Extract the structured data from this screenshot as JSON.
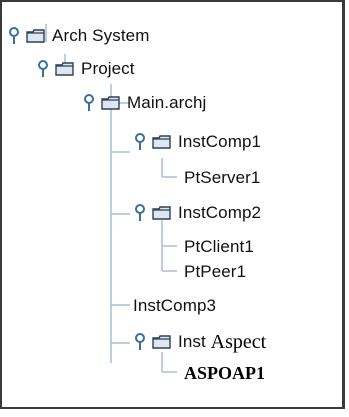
{
  "tree": {
    "nodes": [
      {
        "label": "Arch System"
      },
      {
        "label": "Project"
      },
      {
        "label": "Main.archj"
      },
      {
        "label": "InstComp1"
      },
      {
        "label": "PtServer1"
      },
      {
        "label": "InstComp2"
      },
      {
        "label": "PtClient1"
      },
      {
        "label": "PtPeer1"
      },
      {
        "label": "InstComp3"
      },
      {
        "label_prefix": "Inst ",
        "label_suffix": "Aspect"
      },
      {
        "label": "ASPOAP1"
      }
    ]
  },
  "colors": {
    "line": "#a9bfd6",
    "handle": "#3c6e9b",
    "folder_border": "#2f3f55",
    "folder_fill": "#dde6f1",
    "frame": "#3a3a3a"
  },
  "icons": {
    "expanded_handle": "key-handle-icon",
    "folder": "folder-icon"
  }
}
